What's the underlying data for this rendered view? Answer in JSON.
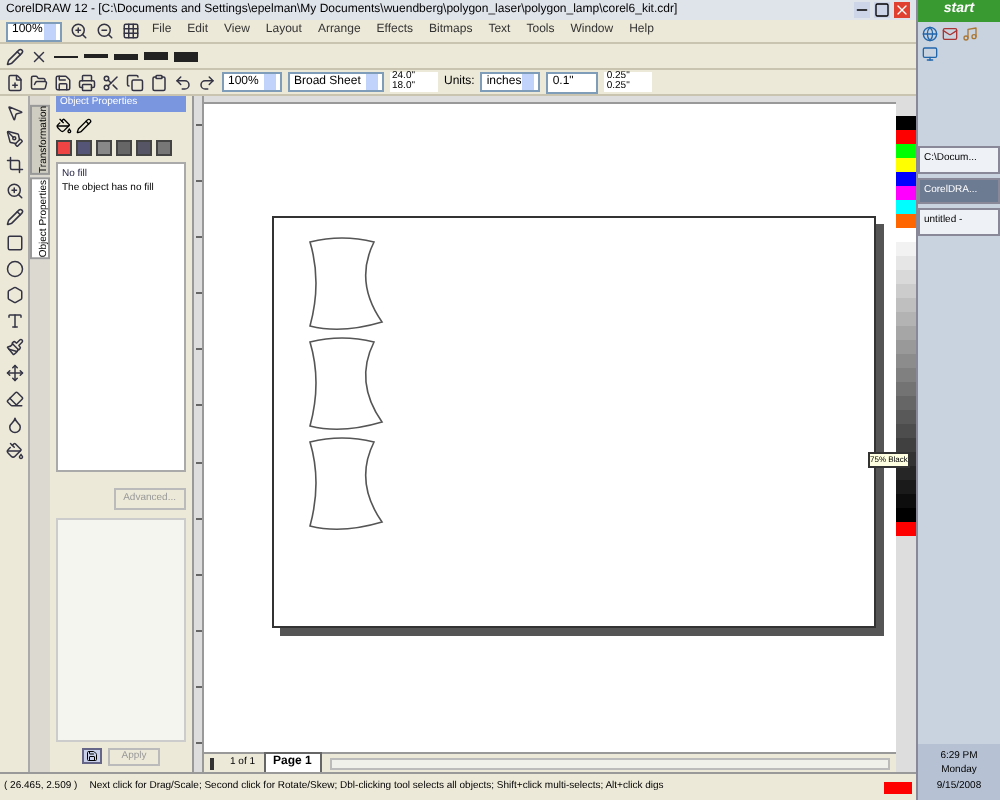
{
  "window": {
    "title": "CorelDRAW 12 - [C:\\Documents and Settings\\epelman\\My Documents\\wuendberg\\polygon_laser\\polygon_lamp\\corel6_kit.cdr]"
  },
  "zoom_combo": "100%",
  "menu": [
    "File",
    "Edit",
    "View",
    "Layout",
    "Arrange",
    "Effects",
    "Bitmaps",
    "Text",
    "Tools",
    "Window",
    "Help"
  ],
  "property_bar": {
    "zoom": "100%",
    "paper": "Broad Sheet",
    "width": "24.0\"",
    "height": "18.0\"",
    "units_label": "Units:",
    "units": "inches",
    "nudge": "0.1\"",
    "dup_x": "0.25\"",
    "dup_y": "0.25\""
  },
  "docker": {
    "title": "Object Properties",
    "side_tabs": [
      {
        "label": "Transformation",
        "selected": false
      },
      {
        "label": "Object Properties",
        "selected": true
      }
    ],
    "fill_name": "No fill",
    "fill_desc": "The object has no fill",
    "advanced_button": "Advanced...",
    "apply_button": "Apply"
  },
  "page_nav": {
    "count": "1 of 1",
    "tabs": [
      {
        "label": "Page 1",
        "selected": true
      }
    ]
  },
  "palette": [
    {
      "color": "#000000"
    },
    {
      "color": "#ff0000"
    },
    {
      "color": "#00ff00"
    },
    {
      "color": "#ffff00"
    },
    {
      "color": "#0000ff"
    },
    {
      "color": "#ff00ff"
    },
    {
      "color": "#00ffff"
    },
    {
      "color": "#ff6600"
    },
    {
      "color": "#ffffff"
    },
    {
      "color": "#f2f2f2"
    },
    {
      "color": "#e6e6e6"
    },
    {
      "color": "#d9d9d9"
    },
    {
      "color": "#cccccc"
    },
    {
      "color": "#bfbfbf"
    },
    {
      "color": "#b3b3b3"
    },
    {
      "color": "#a6a6a6"
    },
    {
      "color": "#999999"
    },
    {
      "color": "#8c8c8c"
    },
    {
      "color": "#808080"
    },
    {
      "color": "#737373"
    },
    {
      "color": "#666666"
    },
    {
      "color": "#595959"
    },
    {
      "color": "#4d4d4d"
    },
    {
      "color": "#404040"
    },
    {
      "color": "#333333"
    },
    {
      "color": "#262626"
    },
    {
      "color": "#1a1a1a"
    },
    {
      "color": "#0d0d0d"
    },
    {
      "color": "#000000"
    },
    {
      "color": "#ff0000"
    }
  ],
  "tooltip": "75% Black",
  "status": {
    "coords": "( 26.465, 2.509 )",
    "hint": "Next click for Drag/Scale; Second click for Rotate/Skew; Dbl-clicking tool selects all objects; Shift+click multi-selects; Alt+click digs"
  },
  "taskbar": {
    "start": "start",
    "tasks": [
      {
        "label": "C:\\Docum...",
        "selected": false
      },
      {
        "label": "CorelDRA...",
        "selected": true
      },
      {
        "label": "untitled -",
        "selected": false
      }
    ],
    "time": "6:29 PM",
    "day": "Monday",
    "date": "9/15/2008"
  }
}
